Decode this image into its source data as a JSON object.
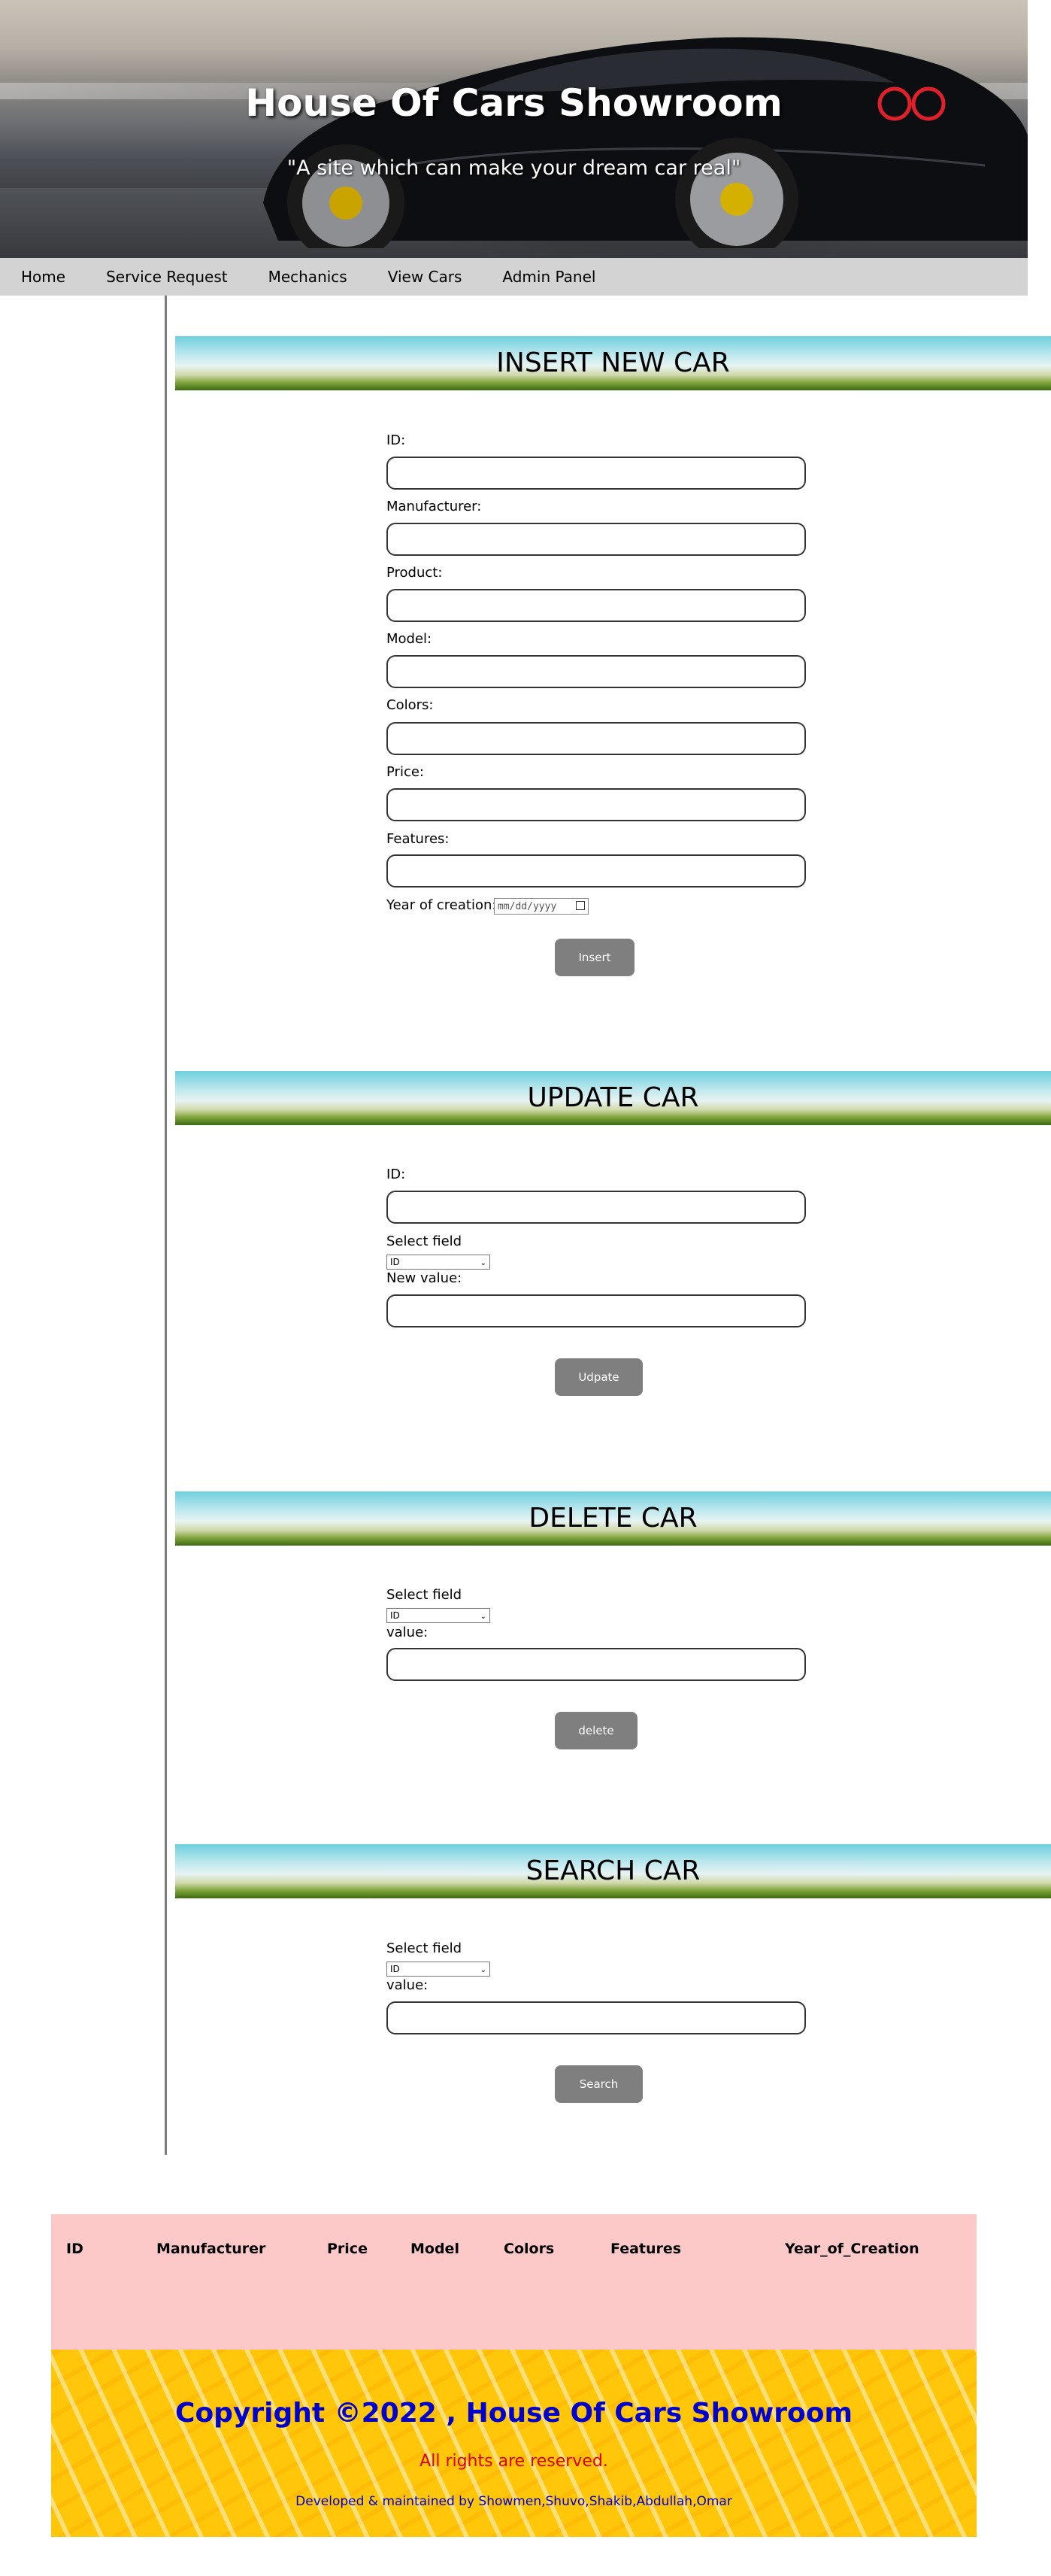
{
  "header": {
    "title": "House Of Cars Showroom",
    "subtitle": "\"A site which can make your dream car real\""
  },
  "nav": {
    "items": [
      "Home",
      "Service Request",
      "Mechanics",
      "View Cars",
      "Admin Panel"
    ]
  },
  "insert": {
    "heading": "INSERT NEW CAR",
    "labels": {
      "id": "ID:",
      "manufacturer": "Manufacturer:",
      "product": "Product:",
      "model": "Model:",
      "colors": "Colors:",
      "price": "Price:",
      "features": "Features:",
      "year": "Year of creation:"
    },
    "date_placeholder": "mm/dd/yyyy",
    "button": "Insert"
  },
  "update": {
    "heading": "UPDATE CAR",
    "id_label": "ID:",
    "select_label": "Select field",
    "select_value": "ID",
    "value_label": "New value:",
    "button": "Udpate"
  },
  "delete": {
    "heading": "DELETE CAR",
    "select_label": "Select field",
    "select_value": "ID",
    "value_label": "value:",
    "button": "delete"
  },
  "search": {
    "heading": "SEARCH CAR",
    "select_label": "Select field",
    "select_value": "ID",
    "value_label": "value:",
    "button": "Search"
  },
  "table": {
    "columns": [
      "ID",
      "Manufacturer",
      "Price",
      "Model",
      "Colors",
      "Features",
      "Year_of_Creation"
    ]
  },
  "footer": {
    "copyright": "Copyright ©2022 , House Of Cars Showroom",
    "rights": "All rights are reserved.",
    "developers": "Developed & maintained by Showmen,Shuvo,Shakib,Abdullah,Omar"
  }
}
